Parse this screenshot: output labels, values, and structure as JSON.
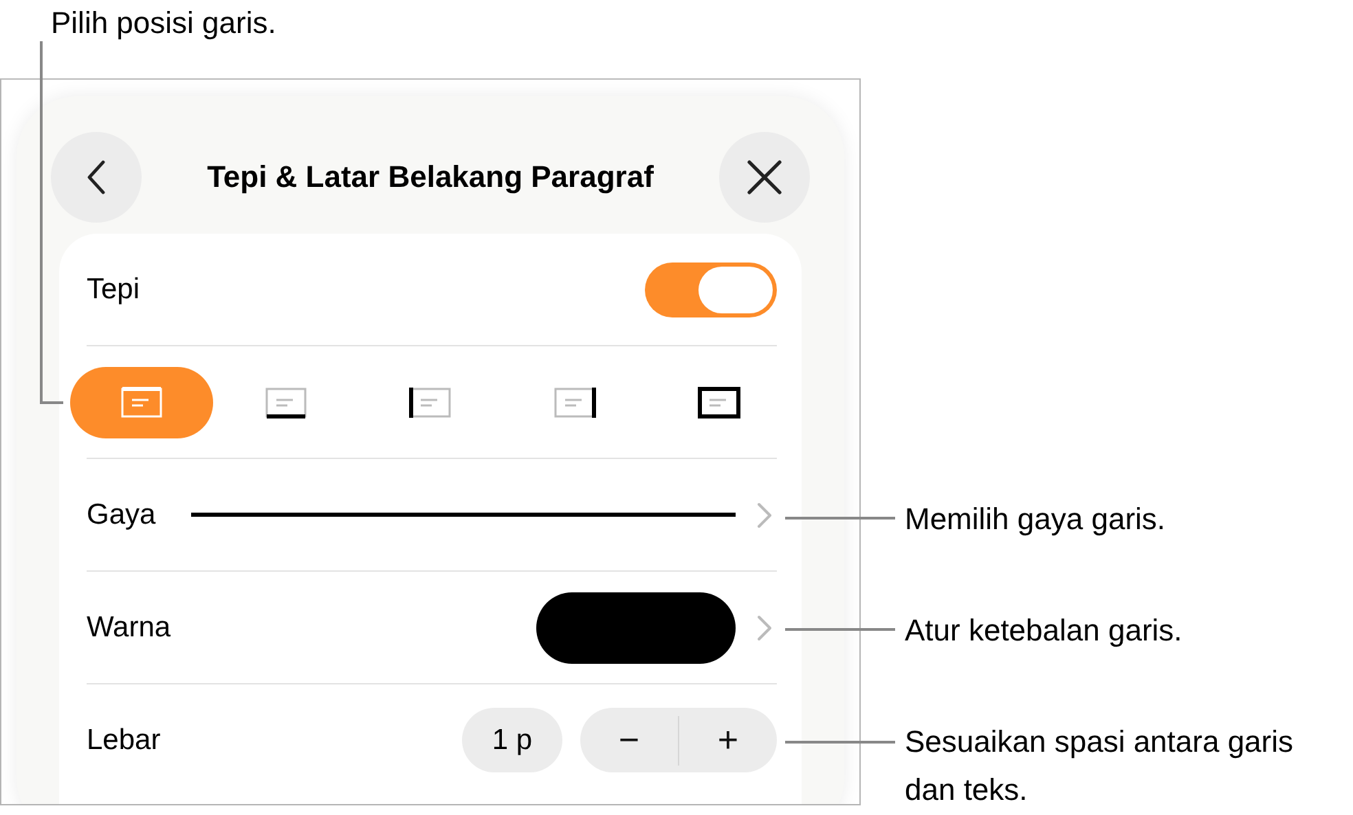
{
  "panel": {
    "title": "Tepi & Latar Belakang Paragraf"
  },
  "border_toggle": {
    "label": "Tepi",
    "on": true
  },
  "border_positions": [
    {
      "kind": "top",
      "selected": true
    },
    {
      "kind": "bottom",
      "selected": false
    },
    {
      "kind": "left",
      "selected": false
    },
    {
      "kind": "right",
      "selected": false
    },
    {
      "kind": "box",
      "selected": false
    }
  ],
  "style_row": {
    "label": "Gaya"
  },
  "color_row": {
    "label": "Warna"
  },
  "width_row": {
    "label": "Lebar",
    "value": "1 p",
    "minus": "−",
    "plus": "+"
  },
  "callouts": [
    {
      "text": "Pilih posisi garis."
    },
    {
      "text": "Memilih gaya garis."
    },
    {
      "text": "Atur ketebalan garis."
    },
    {
      "text": "Sesuaikan spasi antara garis dan teks."
    }
  ]
}
